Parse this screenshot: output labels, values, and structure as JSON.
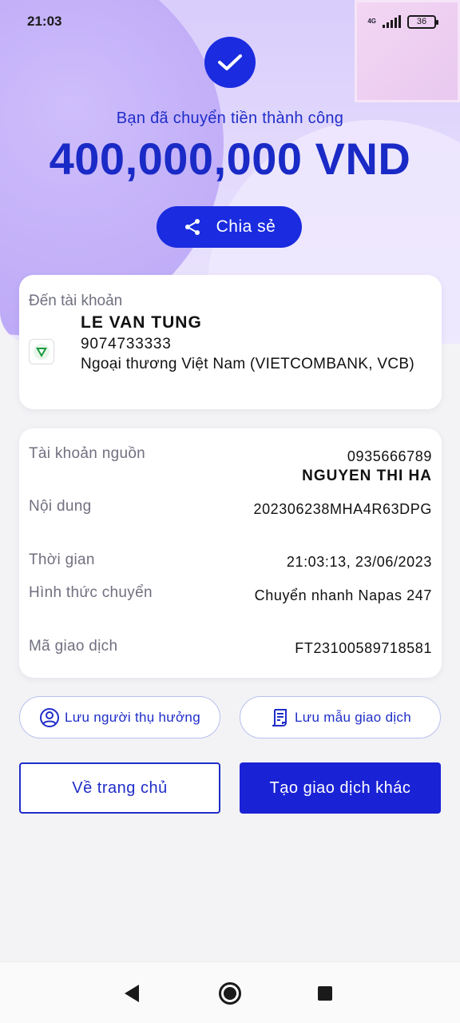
{
  "status_bar": {
    "time": "21:03",
    "network": "4G",
    "battery": "36"
  },
  "hero": {
    "success_message": "Bạn đã chuyển tiền thành công",
    "amount": "400,000,000 VND",
    "share_label": "Chia sẻ"
  },
  "recipient": {
    "label": "Đến tài khoản",
    "name": "LE VAN TUNG",
    "account_number": "9074733333",
    "bank": "Ngoại thương Việt Nam (VIETCOMBANK, VCB)"
  },
  "details": {
    "source_label": "Tài khoản nguồn",
    "source_account": "0935666789",
    "source_name": "NGUYEN THI HA",
    "content_label": "Nội dung",
    "content_value": "202306238MHA4R63DPG",
    "time_label": "Thời gian",
    "time_value": "21:03:13, 23/06/2023",
    "method_label": "Hình thức chuyển",
    "method_value": "Chuyển nhanh Napas 247",
    "txn_label": "Mã giao dịch",
    "txn_value": "FT23100589718581"
  },
  "actions": {
    "save_beneficiary": "Lưu người thụ hưởng",
    "save_template": "Lưu mẫu giao dịch",
    "home": "Về trang chủ",
    "new_transaction": "Tạo giao dịch khác"
  },
  "colors": {
    "primary": "#1a2be0",
    "accent_text": "#1f2dc8"
  },
  "icons": [
    "check-icon",
    "share-icon",
    "vietcombank-logo",
    "user-circle-icon",
    "receipt-icon",
    "back-icon",
    "home-icon",
    "recents-icon"
  ]
}
